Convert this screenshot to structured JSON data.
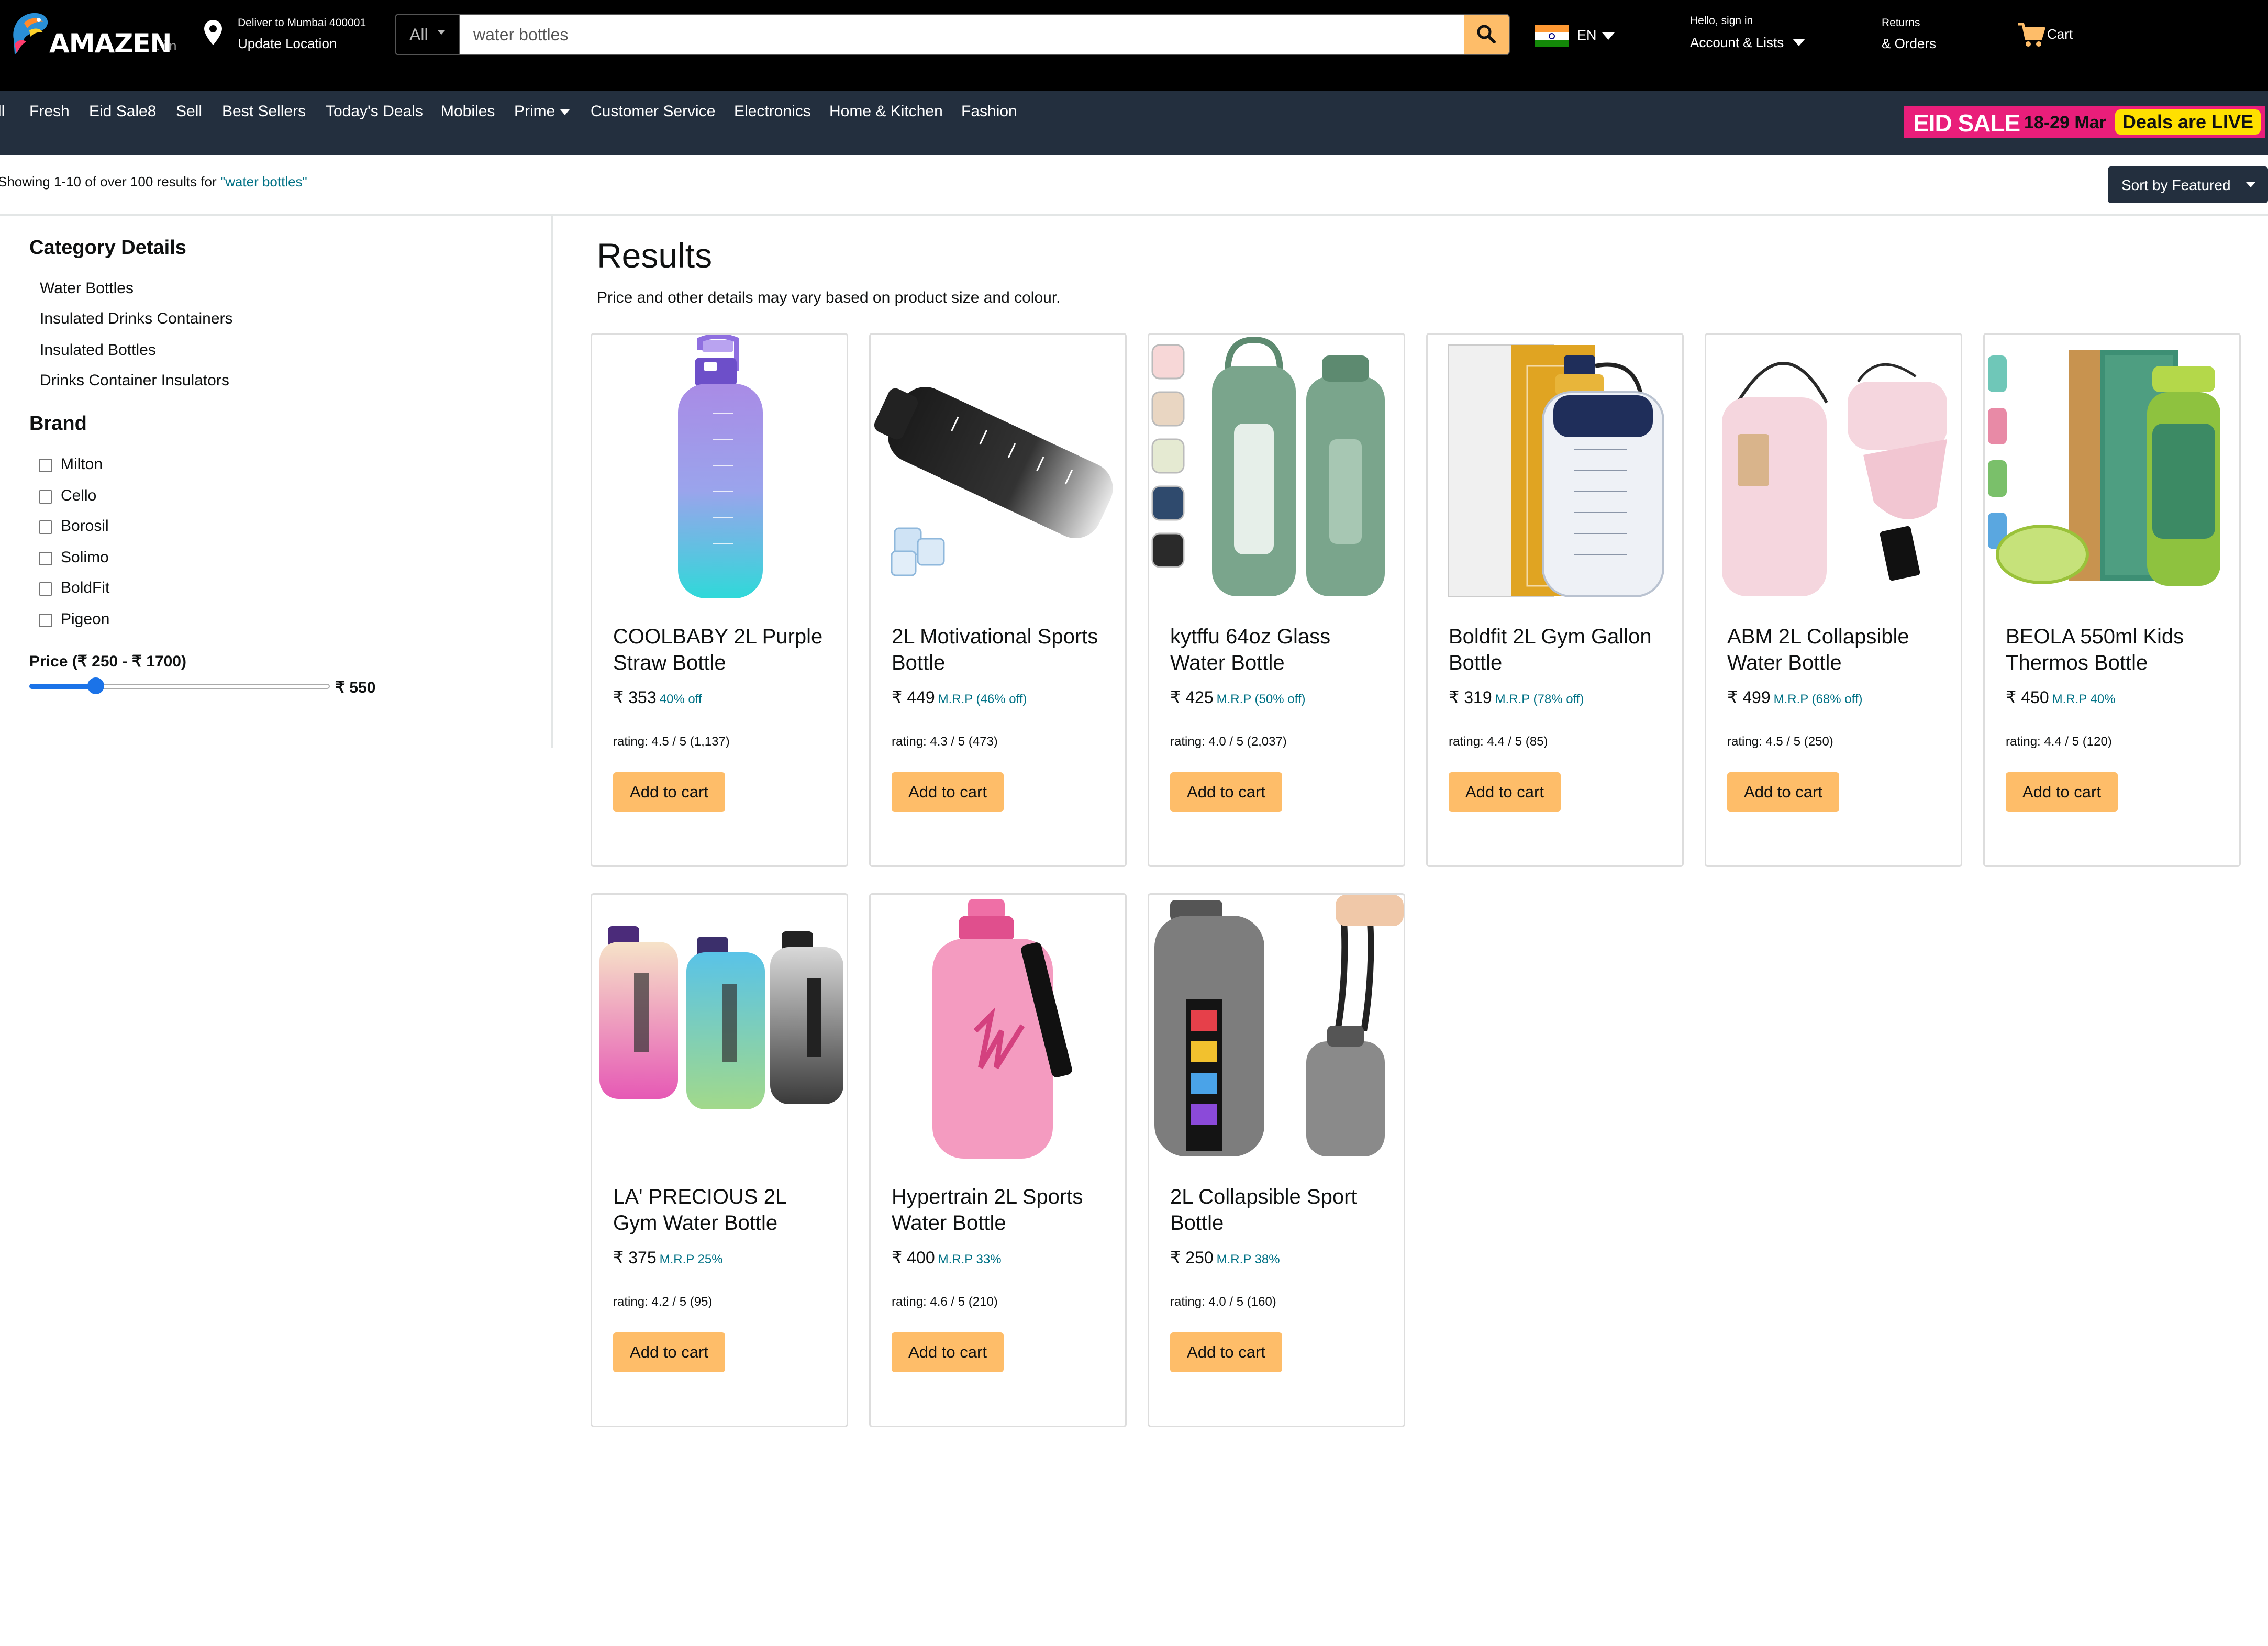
{
  "header": {
    "logo": "AMAZEN",
    "logo_suffix": ".in",
    "deliver_line1": "Deliver to Mumbai 400001",
    "deliver_line2": "Update Location",
    "search_category": "All",
    "search_value": "water bottles",
    "language": "EN",
    "account_line1": "Hello, sign in",
    "account_line2": "Account & Lists",
    "returns_line1": "Returns",
    "returns_line2": "& Orders",
    "cart_label": "Cart",
    "icons": [
      "location-pin-icon",
      "search-icon",
      "india-flag-icon",
      "cart-icon"
    ]
  },
  "nav": {
    "items": [
      "ll",
      "Fresh",
      "Eid Sale8",
      "Sell",
      "Best Sellers",
      "Today's Deals",
      "Mobiles",
      "Prime",
      "Customer Service",
      "Electronics",
      "Home & Kitchen",
      "Fashion"
    ],
    "banner": {
      "main": "EID SALE",
      "dates": "18-29 Mar",
      "live": "Deals are LIVE"
    }
  },
  "results_bar": {
    "count_text": "Showing 1-10 of over 100 results for",
    "query_text": "\"water bottles\"",
    "sort_label": "Sort by Featured"
  },
  "sidebar": {
    "category_heading": "Category Details",
    "categories": [
      "Water Bottles",
      "Insulated Drinks Containers",
      "Insulated Bottles",
      "Drinks Container Insulators"
    ],
    "brand_heading": "Brand",
    "brands": [
      "Milton",
      "Cello",
      "Borosil",
      "Solimo",
      "BoldFit",
      "Pigeon"
    ],
    "price_label": "Price (₹ 250 - ₹ 1700)",
    "price_min": 250,
    "price_max": 1700,
    "price_selected": 550,
    "price_value_text": "₹ 550"
  },
  "main": {
    "title": "Results",
    "subtitle": "Price and other details may vary based on product size and colour.",
    "add_to_cart_label": "Add to cart",
    "products": [
      {
        "title": "COOLBABY 2L Purple Straw Bottle",
        "price": "₹ 353",
        "discount": "40% off",
        "rating": "rating: 4.5 / 5 (1,137)",
        "image": "purple-gradient-bottle"
      },
      {
        "title": "2L Motivational Sports Bottle",
        "price": "₹ 449",
        "discount": "M.R.P (46% off)",
        "rating": "rating: 4.3 / 5 (473)",
        "image": "black-tilted-bottle"
      },
      {
        "title": "kytffu 64oz Glass Water Bottle",
        "price": "₹ 425",
        "discount": "M.R.P (50% off)",
        "rating": "rating: 4.0 / 5 (2,037)",
        "image": "green-glass-bottles"
      },
      {
        "title": "Boldfit 2L Gym Gallon Bottle",
        "price": "₹ 319",
        "discount": "M.R.P (78% off)",
        "rating": "rating: 4.4 / 5 (85)",
        "image": "clear-gallon-bottle"
      },
      {
        "title": "ABM 2L Collapsible Water Bottle",
        "price": "₹ 499",
        "discount": "M.R.P (68% off)",
        "rating": "rating: 4.5 / 5 (250)",
        "image": "pink-collapsible-bottle"
      },
      {
        "title": "BEOLA 550ml Kids Thermos Bottle",
        "price": "₹ 450",
        "discount": "M.R.P 40%",
        "rating": "rating: 4.4 / 5 (120)",
        "image": "green-kids-thermos"
      },
      {
        "title": "LA' PRECIOUS 2L Gym Water Bottle",
        "price": "₹ 375",
        "discount": "M.R.P 25%",
        "rating": "rating: 4.2 / 5 (95)",
        "image": "three-gradient-bottles"
      },
      {
        "title": "Hypertrain 2L Sports Water Bottle",
        "price": "₹ 400",
        "discount": "M.R.P 33%",
        "rating": "rating: 4.6 / 5 (210)",
        "image": "pink-jug-bottle"
      },
      {
        "title": "2L Collapsible Sport Bottle",
        "price": "₹ 250",
        "discount": "M.R.P 38%",
        "rating": "rating: 4.0 / 5 (160)",
        "image": "grey-collapsible-bottle"
      }
    ]
  },
  "colors": {
    "header_bg": "#000000",
    "nav_bg": "#232f3e",
    "accent_button": "#febd69",
    "link_teal": "#007185",
    "slider_blue": "#1b73e8",
    "banner_pink": "#e91e7a",
    "banner_yellow": "#ffe000"
  }
}
